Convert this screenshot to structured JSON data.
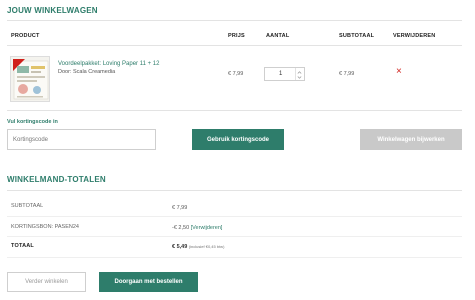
{
  "cart": {
    "title": "JOUW WINKELWAGEN",
    "columns": {
      "product": "PRODUCT",
      "price": "PRIJS",
      "quantity": "AANTAL",
      "subtotal": "SUBTOTAAL",
      "remove": "VERWIJDEREN"
    },
    "item": {
      "name": "Voordeelpakket: Loving Paper 11 + 12",
      "publisher": "Door: Scala Creamedia",
      "price": "€ 7,99",
      "quantity": "1",
      "subtotal": "€ 7,99",
      "remove_glyph": "×"
    },
    "coupon": {
      "label": "Vul kortingscode in",
      "placeholder": "Kortingscode",
      "apply_button": "Gebruik kortingscode"
    },
    "update_button": "Winkelwagen bijwerken"
  },
  "totals": {
    "title": "WINKELMAND-TOTALEN",
    "subtotal_label": "SUBTOTAAL",
    "subtotal_value": "€ 7,99",
    "discount_label": "KORTINGSBON: PASEN24",
    "discount_value": "-€ 2,50",
    "discount_remove": "[Verwijderen]",
    "total_label": "TOTAAL",
    "total_value": "€ 5,49",
    "total_note": "(inclusief €0,45 btw)"
  },
  "actions": {
    "continue_shopping": "Verder winkelen",
    "checkout": "Doorgaan met bestellen"
  },
  "colors": {
    "accent": "#2e7d6b",
    "remove": "#d0201b",
    "disabled": "#c9c9c9"
  },
  "icons": {
    "remove": "close-icon",
    "qty_up": "chevron-up-icon",
    "qty_down": "chevron-down-icon"
  }
}
